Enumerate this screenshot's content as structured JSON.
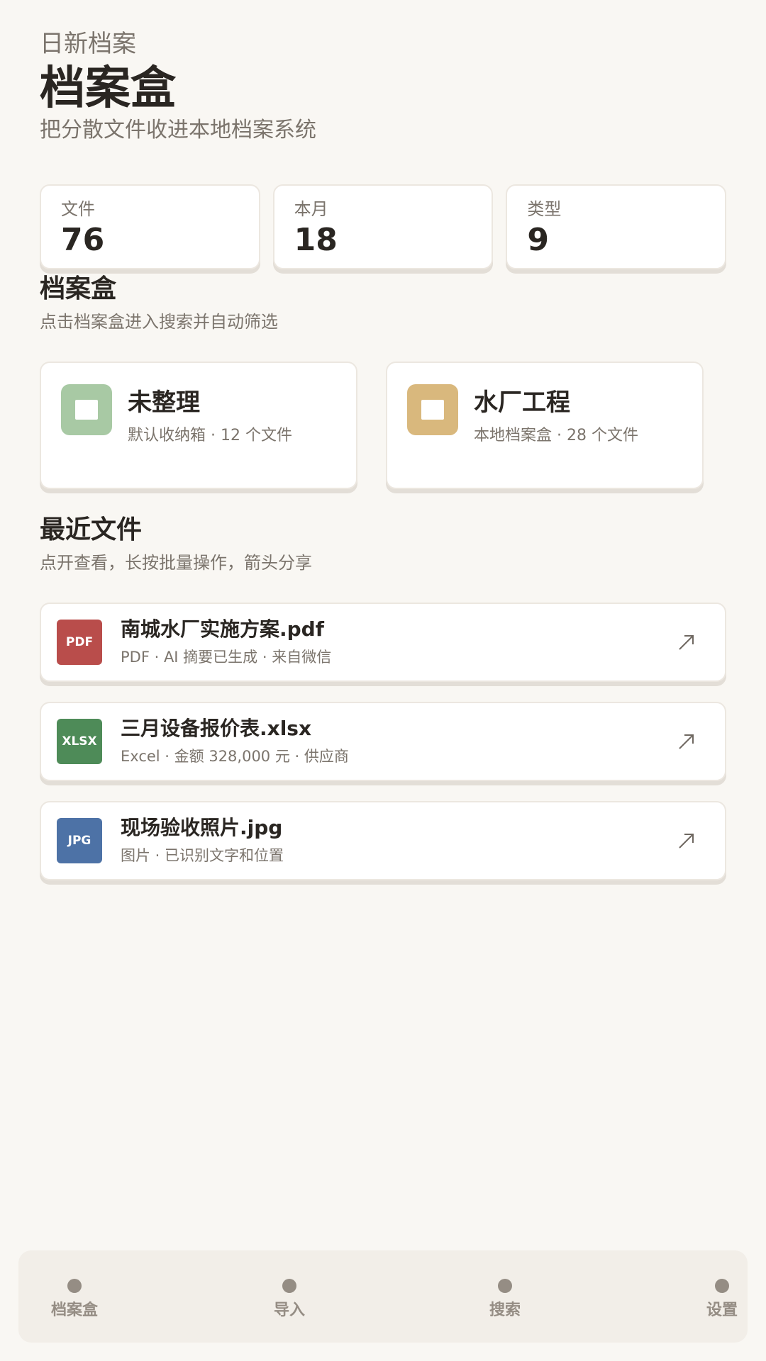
{
  "header": {
    "app_name": "日新档案",
    "title": "档案盒",
    "subtitle": "把分散文件收进本地档案系统"
  },
  "stats": [
    {
      "label": "文件",
      "value": "76"
    },
    {
      "label": "本月",
      "value": "18"
    },
    {
      "label": "类型",
      "value": "9"
    }
  ],
  "boxes_section": {
    "title": "档案盒",
    "subtitle": "点击档案盒进入搜索并自动筛选"
  },
  "boxes": [
    {
      "name": "未整理",
      "meta": "默认收纳箱 · 12 个文件",
      "color": "#a8c9a4"
    },
    {
      "name": "水厂工程",
      "meta": "本地档案盒 · 28 个文件",
      "color": "#d9b87d"
    }
  ],
  "recent_section": {
    "title": "最近文件",
    "subtitle": "点开查看，长按批量操作，箭头分享"
  },
  "files": [
    {
      "badge": "PDF",
      "badge_color": "#b94d4b",
      "name": "南城水厂实施方案.pdf",
      "meta": "PDF · AI 摘要已生成 · 来自微信",
      "share_icon": "share-arrow-icon"
    },
    {
      "badge": "XLSX",
      "badge_color": "#4e8b58",
      "name": "三月设备报价表.xlsx",
      "meta": "Excel · 金额 328,000 元 · 供应商",
      "share_icon": "share-arrow-icon"
    },
    {
      "badge": "JPG",
      "badge_color": "#4d72a6",
      "name": "现场验收照片.jpg",
      "meta": "图片 · 已识别文字和位置",
      "share_icon": "share-arrow-icon"
    }
  ],
  "tabbar": {
    "items": [
      {
        "label": "档案盒"
      },
      {
        "label": "导入"
      },
      {
        "label": "搜索"
      },
      {
        "label": "设置"
      }
    ]
  }
}
